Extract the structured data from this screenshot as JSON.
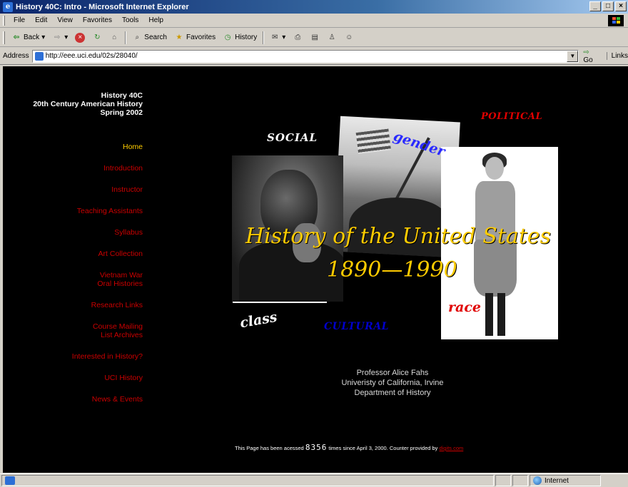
{
  "window": {
    "title": "History 40C: Intro - Microsoft Internet Explorer",
    "controls": [
      "_",
      "□",
      "×"
    ]
  },
  "menu": [
    "File",
    "Edit",
    "View",
    "Favorites",
    "Tools",
    "Help"
  ],
  "toolbar": {
    "back": "Back",
    "search": "Search",
    "favorites": "Favorites",
    "history": "History"
  },
  "address": {
    "label": "Address",
    "url": "http://eee.uci.edu/02s/28040/",
    "go": "Go",
    "links": "Links"
  },
  "page": {
    "course_title": [
      "History 40C",
      "20th Century American History",
      "Spring 2002"
    ],
    "nav": [
      {
        "label": "Home",
        "active": true
      },
      {
        "label": "Introduction"
      },
      {
        "label": "Instructor"
      },
      {
        "label": "Teaching Assistants"
      },
      {
        "label": "Syllabus"
      },
      {
        "label": "Art Collection"
      },
      {
        "label": "Vietnam War Oral Histories",
        "lines": [
          "Vietnam War",
          "Oral Histories"
        ]
      },
      {
        "label": "Research Links"
      },
      {
        "label": "Course Mailing List Archives",
        "lines": [
          "Course Mailing",
          "List Archives"
        ]
      },
      {
        "label": "Interested in History?"
      },
      {
        "label": "UCI History"
      },
      {
        "label": "News & Events"
      }
    ],
    "collage": {
      "social": "SOCIAL",
      "gender": "gender",
      "political": "POLITICAL",
      "class": "class",
      "cultural": "CULTURAL",
      "race": "race",
      "title": "History of the United States",
      "years": "1890—1990"
    },
    "professor": [
      "Professor Alice Fahs",
      "Univeristy of California, Irvine",
      "Department of History"
    ],
    "counter": {
      "prefix": "This Page has been acessed",
      "count": "8356",
      "middle": "times since April 3, 2000.  Counter provided by",
      "link": "digits.com"
    }
  },
  "status": {
    "zone": "Internet"
  }
}
